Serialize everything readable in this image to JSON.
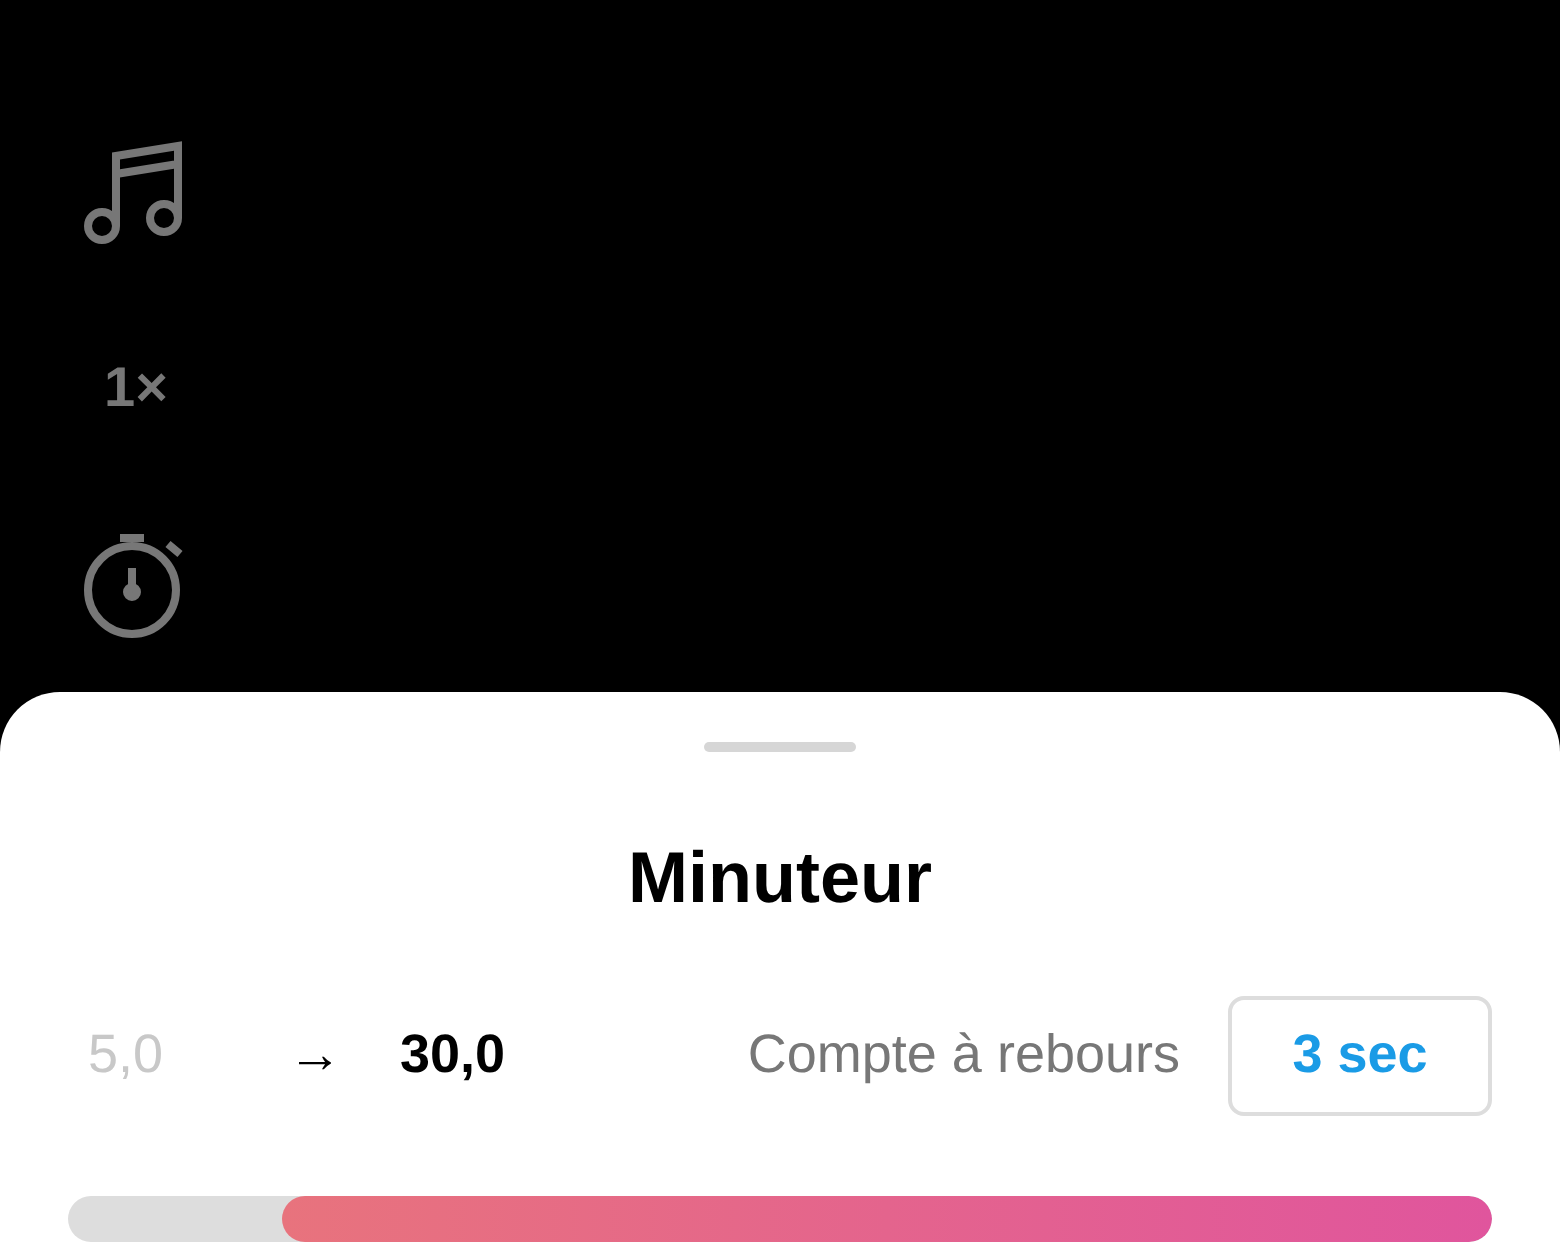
{
  "side_tools": [
    {
      "kind": "music"
    },
    {
      "kind": "speed",
      "label": "1×"
    },
    {
      "kind": "timer"
    }
  ],
  "sheet": {
    "title": "Minuteur",
    "start": "5,0",
    "arrow": "→",
    "end": "30,0",
    "countdown_label": "Compte à rebours",
    "countdown_button": "3 sec",
    "range_bar": {
      "level": 0.85
    }
  }
}
